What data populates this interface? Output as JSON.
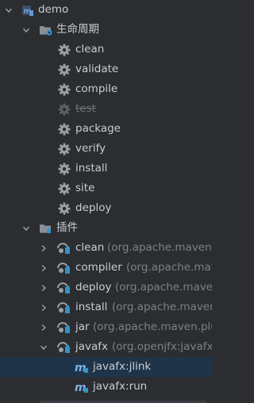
{
  "tree": {
    "root": {
      "label": "demo"
    },
    "lifecycle": {
      "label": "生命周期",
      "phases": [
        {
          "label": "clean",
          "disabled": false
        },
        {
          "label": "validate",
          "disabled": false
        },
        {
          "label": "compile",
          "disabled": false
        },
        {
          "label": "test",
          "disabled": true
        },
        {
          "label": "package",
          "disabled": false
        },
        {
          "label": "verify",
          "disabled": false
        },
        {
          "label": "install",
          "disabled": false
        },
        {
          "label": "site",
          "disabled": false
        },
        {
          "label": "deploy",
          "disabled": false
        }
      ]
    },
    "plugins": {
      "label": "插件",
      "items": [
        {
          "name": "clean",
          "coords": "(org.apache.maven.",
          "expanded": false
        },
        {
          "name": "compiler",
          "coords": "(org.apache.mav",
          "expanded": false
        },
        {
          "name": "deploy",
          "coords": "(org.apache.maven",
          "expanded": false
        },
        {
          "name": "install",
          "coords": "(org.apache.maven",
          "expanded": false
        },
        {
          "name": "jar",
          "coords": "(org.apache.maven.plu",
          "expanded": false
        },
        {
          "name": "javafx",
          "coords": "(org.openjfx:javafx-",
          "expanded": true
        }
      ],
      "goals": [
        {
          "label": "javafx:jlink",
          "selected": true
        },
        {
          "label": "javafx:run",
          "selected": false
        }
      ]
    }
  },
  "colors": {
    "background": "#2b2d30",
    "selection": "#203449",
    "text": "#c9cdd2",
    "muted": "#7d8187",
    "folder_blue": "#3592c4"
  },
  "icons": {
    "root": "maven-module-icon",
    "lifecycle": "lifecycle-folder-gear-icon",
    "phase": "gear-icon",
    "plugins": "plugins-folder-icon",
    "plugin": "plugin-icon",
    "goal": "maven-goal-icon"
  }
}
